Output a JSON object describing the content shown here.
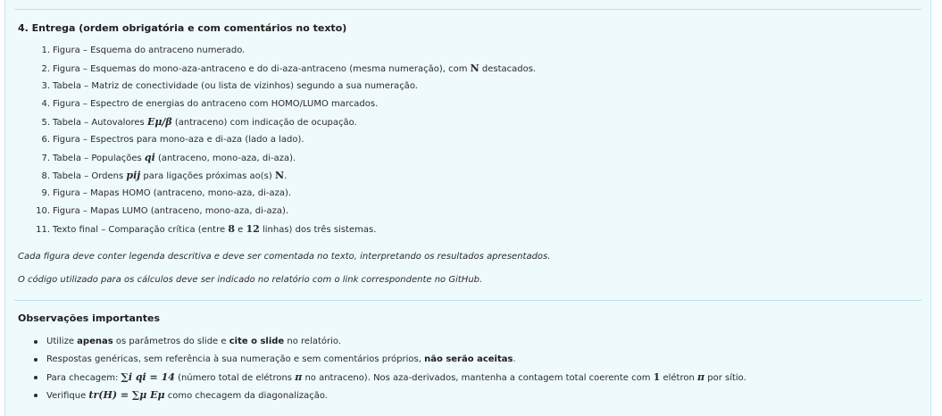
{
  "section_entrega": {
    "heading": "4. Entrega (ordem obrigatória e com comentários no texto)",
    "items": [
      {
        "num": "1.",
        "a": "Figura – Esquema do antraceno numerado."
      },
      {
        "num": "2.",
        "a": "Figura – Esquemas do mono-aza-antraceno e do di-aza-antraceno (mesma numeração), com ",
        "m": "N",
        "b": " destacados."
      },
      {
        "num": "3.",
        "a": "Tabela – Matriz de conectividade (ou lista de vizinhos) segundo a sua numeração."
      },
      {
        "num": "4.",
        "a": "Figura – Espectro de energias do antraceno com HOMO/LUMO marcados."
      },
      {
        "num": "5.",
        "a": "Tabela – Autovalores ",
        "m": "Eμ/β",
        "b": " (antraceno) com indicação de ocupação."
      },
      {
        "num": "6.",
        "a": "Figura – Espectros para mono-aza e di-aza (lado a lado)."
      },
      {
        "num": "7.",
        "a": "Tabela – Populações ",
        "m": "qi",
        "b": " (antraceno, mono-aza, di-aza)."
      },
      {
        "num": "8.",
        "a": "Tabela – Ordens ",
        "m": "pij",
        "b": " para ligações próximas ao(s) ",
        "m2": "N",
        "c": "."
      },
      {
        "num": "9.",
        "a": "Figura – Mapas HOMO (antraceno, mono-aza, di-aza)."
      },
      {
        "num": "10.",
        "a": "Figura – Mapas LUMO (antraceno, mono-aza, di-aza)."
      },
      {
        "num": "11.",
        "a": "Texto final – Comparação crítica (entre ",
        "m": "8",
        "b": " e ",
        "m2": "12",
        "c": " linhas) dos três sistemas."
      }
    ],
    "note1": "Cada figura deve conter legenda descritiva e deve ser comentada no texto, interpretando os resultados apresentados.",
    "note2": "O código utilizado para os cálculos deve ser indicado no relatório com o link correspondente no GitHub."
  },
  "section_obs": {
    "heading": "Observações importantes",
    "items": [
      {
        "p1": "Utilize ",
        "b1": "apenas",
        "p2": " os parâmetros do slide e ",
        "b2": "cite o slide",
        "p3": " no relatório."
      },
      {
        "p1": "Respostas genéricas, sem referência à sua numeração e sem comentários próprios, ",
        "b1": "não serão aceitas",
        "p2": "."
      },
      {
        "p1": "Para checagem: ",
        "m1": "∑i qi = 14",
        "p2": " (número total de elétrons ",
        "m2": "π",
        "p3": " no antraceno). Nos aza-derivados, mantenha a contagem total coerente com ",
        "m3": "1",
        "p4": " elétron ",
        "m4": "π",
        "p5": " por sítio."
      },
      {
        "p1": "Verifique ",
        "m1": "tr(H) = ∑μ Eμ",
        "p2": " como checagem da diagonalização."
      }
    ]
  }
}
